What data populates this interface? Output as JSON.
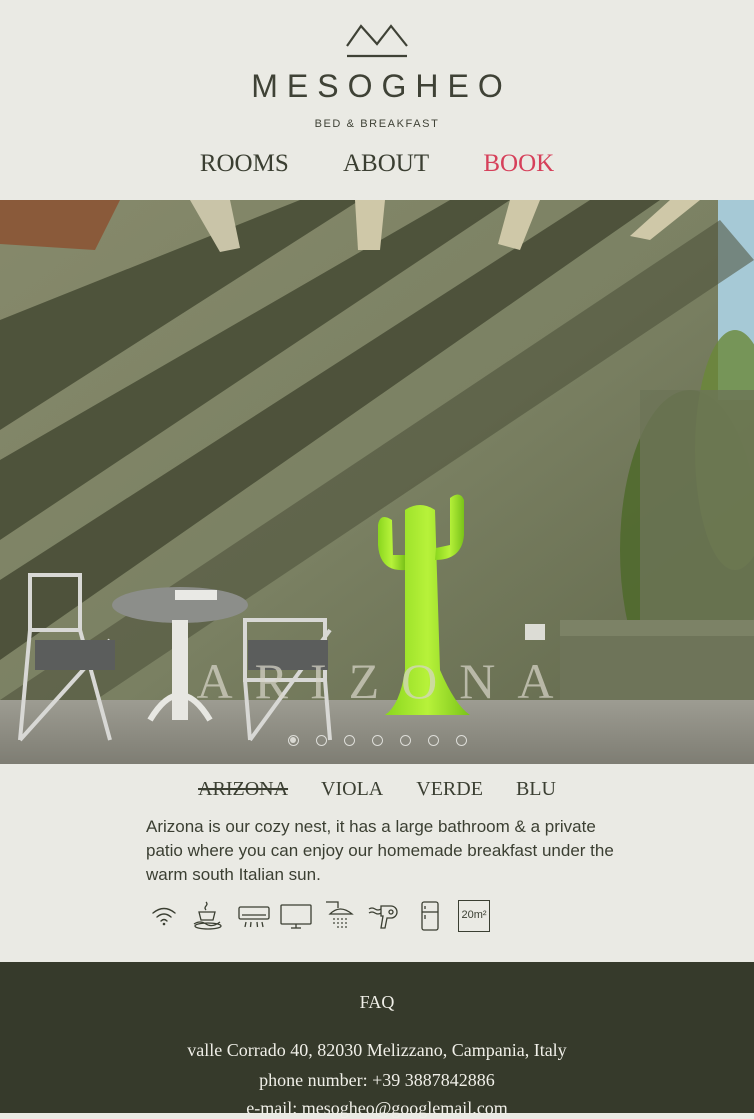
{
  "brand": {
    "logo_icon": "mountain-logo-icon",
    "name": "MESOGHEO",
    "tagline": "BED & BREAKFAST"
  },
  "nav": {
    "rooms": "ROOMS",
    "about": "ABOUT",
    "book": "BOOK"
  },
  "hero": {
    "title": "ARIZONA",
    "slide_count": 7,
    "active_slide": 1
  },
  "rooms": {
    "tabs": [
      "ARIZONA",
      "VIOLA",
      "VERDE",
      "BLU"
    ],
    "current": "ARIZONA",
    "description": "Arizona is our cozy nest, it has a large bathroom & a private patio where you can enjoy our homemade breakfast under the warm south Italian sun."
  },
  "amenities": [
    {
      "icon": "wifi-icon"
    },
    {
      "icon": "breakfast-icon"
    },
    {
      "icon": "air-conditioner-icon"
    },
    {
      "icon": "tv-icon"
    },
    {
      "icon": "shower-icon"
    },
    {
      "icon": "hair-dryer-icon"
    },
    {
      "icon": "fridge-icon"
    },
    {
      "icon": "room-size-icon",
      "label": "20m²"
    }
  ],
  "footer": {
    "faq": "FAQ",
    "address": "valle Corrado 40, 82030 Melizzano, Campania, Italy",
    "phone": "phone number: +39 3887842886",
    "email": "e-mail: mesogheo@googlemail.com"
  },
  "colors": {
    "background": "#eaeae4",
    "text": "#3b3f32",
    "book_accent": "#d6405a",
    "footer_bg": "#363a2b"
  }
}
